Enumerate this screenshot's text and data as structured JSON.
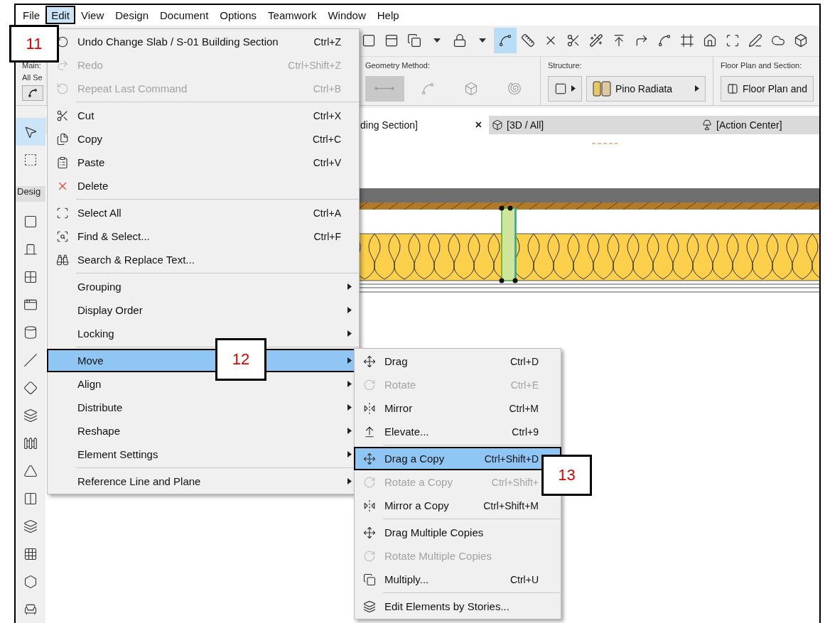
{
  "menubar": [
    {
      "label": "File",
      "selected": false
    },
    {
      "label": "Edit",
      "selected": true
    },
    {
      "label": "View",
      "selected": false
    },
    {
      "label": "Design",
      "selected": false
    },
    {
      "label": "Document",
      "selected": false
    },
    {
      "label": "Options",
      "selected": false
    },
    {
      "label": "Teamwork",
      "selected": false
    },
    {
      "label": "Window",
      "selected": false
    },
    {
      "label": "Help",
      "selected": false
    }
  ],
  "toolbar": {
    "buttons": [
      {
        "selected": false
      },
      {
        "selected": false
      },
      {
        "selected": false
      },
      {
        "selected": false
      },
      {
        "selected": false
      },
      {
        "selected": false
      },
      {
        "selected": true
      },
      {
        "selected": false
      },
      {
        "selected": false
      },
      {
        "selected": false
      },
      {
        "selected": false
      },
      {
        "selected": false
      },
      {
        "selected": false
      },
      {
        "selected": false
      },
      {
        "selected": false
      },
      {
        "selected": false
      },
      {
        "selected": false
      },
      {
        "selected": false
      },
      {
        "selected": false
      },
      {
        "selected": false
      }
    ]
  },
  "info_box": {
    "main_label": "Main:",
    "selection_label": "All Se",
    "geometry_label": "Geometry Method:",
    "geometry_methods": [
      {
        "selected": true
      },
      {
        "selected": false
      },
      {
        "selected": false
      },
      {
        "selected": false
      }
    ],
    "structure_label": "Structure:",
    "structure_value": "Pino Radiata",
    "floor_label": "Floor Plan and Section:",
    "floor_value": "Floor Plan and"
  },
  "toolbox": {
    "tools": [
      {
        "selected": true
      },
      {
        "selected": false
      }
    ],
    "section_label": "Desig"
  },
  "tabs": [
    {
      "label": "ding Section]",
      "selected": true,
      "close": "×"
    },
    {
      "label": "[3D / All]",
      "selected": false
    },
    {
      "label": "[Action Center]",
      "selected": false
    }
  ],
  "edit_menu": {
    "groups": [
      [
        {
          "label": "Undo Change Slab / S-01 Building Section",
          "shortcut": "Ctrl+Z",
          "disabled": false,
          "selected": false,
          "submenu": false
        },
        {
          "label": "Redo",
          "shortcut": "Ctrl+Shift+Z",
          "disabled": true,
          "selected": false,
          "submenu": false
        },
        {
          "label": "Repeat Last Command",
          "shortcut": "Ctrl+B",
          "disabled": true,
          "selected": false,
          "submenu": false
        }
      ],
      [
        {
          "label": "Cut",
          "shortcut": "Ctrl+X",
          "disabled": false,
          "selected": false,
          "submenu": false
        },
        {
          "label": "Copy",
          "shortcut": "Ctrl+C",
          "disabled": false,
          "selected": false,
          "submenu": false
        },
        {
          "label": "Paste",
          "shortcut": "Ctrl+V",
          "disabled": false,
          "selected": false,
          "submenu": false
        },
        {
          "label": "Delete",
          "disabled": false,
          "selected": false,
          "submenu": false
        }
      ],
      [
        {
          "label": "Select All",
          "shortcut": "Ctrl+A",
          "disabled": false,
          "selected": false,
          "submenu": false
        },
        {
          "label": "Find & Select...",
          "shortcut": "Ctrl+F",
          "disabled": false,
          "selected": false,
          "submenu": false
        },
        {
          "label": "Search & Replace Text...",
          "disabled": false,
          "selected": false,
          "submenu": false
        }
      ],
      [
        {
          "label": "Grouping",
          "disabled": false,
          "selected": false,
          "submenu": true
        },
        {
          "label": "Display Order",
          "disabled": false,
          "selected": false,
          "submenu": true
        },
        {
          "label": "Locking",
          "disabled": false,
          "selected": false,
          "submenu": true
        }
      ],
      [
        {
          "label": "Move",
          "disabled": false,
          "selected": true,
          "submenu": true
        },
        {
          "label": "Align",
          "disabled": false,
          "selected": false,
          "submenu": true
        },
        {
          "label": "Distribute",
          "disabled": false,
          "selected": false,
          "submenu": true
        },
        {
          "label": "Reshape",
          "disabled": false,
          "selected": false,
          "submenu": true
        },
        {
          "label": "Element Settings",
          "disabled": false,
          "selected": false,
          "submenu": true
        }
      ],
      [
        {
          "label": "Reference Line and Plane",
          "disabled": false,
          "selected": false,
          "submenu": true
        }
      ]
    ]
  },
  "move_submenu": {
    "groups": [
      [
        {
          "label": "Drag",
          "shortcut": "Ctrl+D",
          "disabled": false,
          "selected": false
        },
        {
          "label": "Rotate",
          "shortcut": "Ctrl+E",
          "disabled": true,
          "selected": false
        },
        {
          "label": "Mirror",
          "shortcut": "Ctrl+M",
          "disabled": false,
          "selected": false
        },
        {
          "label": "Elevate...",
          "shortcut": "Ctrl+9",
          "disabled": false,
          "selected": false
        }
      ],
      [
        {
          "label": "Drag a Copy",
          "shortcut": "Ctrl+Shift+D",
          "disabled": false,
          "selected": true
        },
        {
          "label": "Rotate a Copy",
          "shortcut": "Ctrl+Shift+",
          "disabled": true,
          "selected": false
        },
        {
          "label": "Mirror a Copy",
          "shortcut": "Ctrl+Shift+M",
          "disabled": false,
          "selected": false
        }
      ],
      [
        {
          "label": "Drag Multiple Copies",
          "disabled": false,
          "selected": false
        },
        {
          "label": "Rotate Multiple Copies",
          "disabled": true,
          "selected": false
        },
        {
          "label": "Multiply...",
          "shortcut": "Ctrl+U",
          "disabled": false,
          "selected": false
        }
      ],
      [
        {
          "label": "Edit Elements by Stories...",
          "disabled": false,
          "selected": false
        }
      ]
    ]
  },
  "callouts": [
    "11",
    "12",
    "13"
  ]
}
